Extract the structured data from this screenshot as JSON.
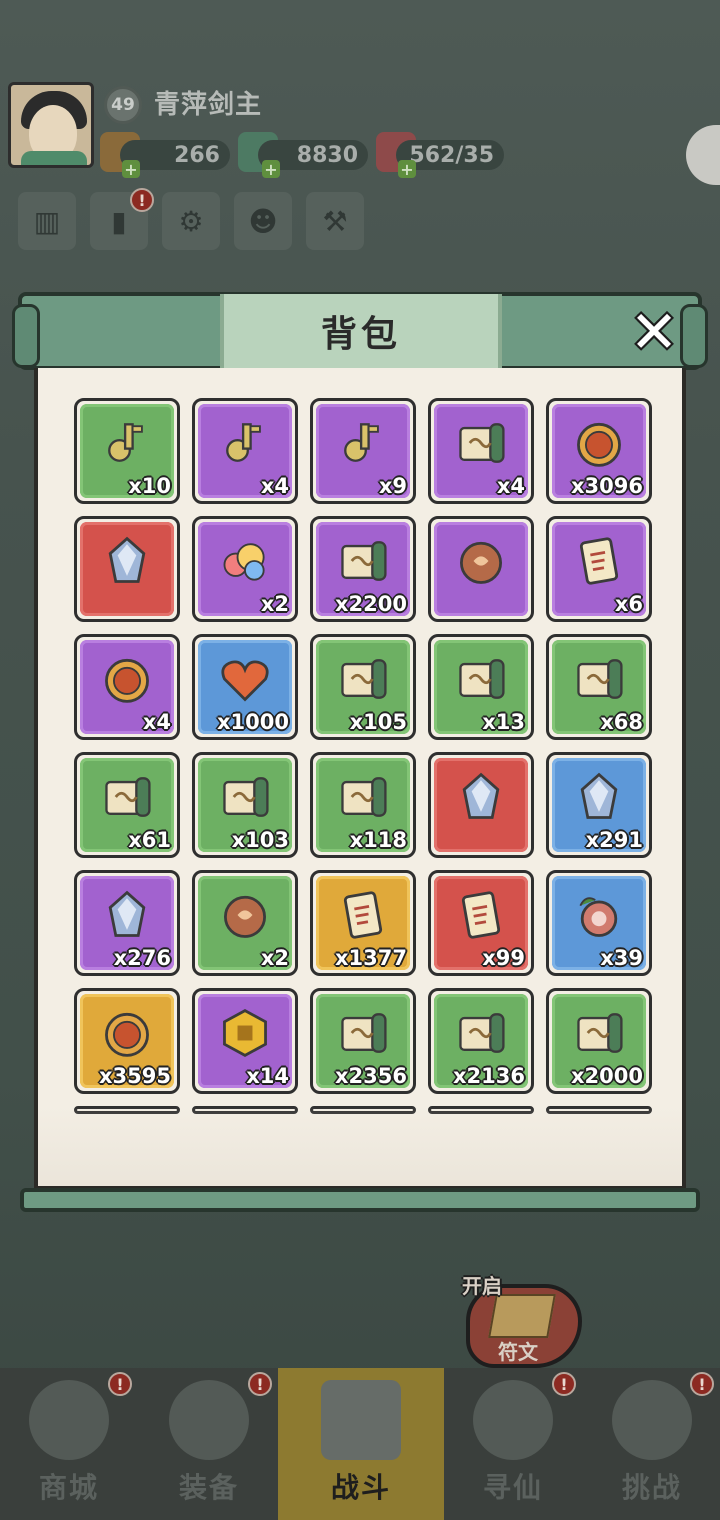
{
  "player": {
    "level": "49",
    "name": "青萍剑主"
  },
  "resources": [
    {
      "name": "gold",
      "value": "266"
    },
    {
      "name": "jade",
      "value": "8830"
    },
    {
      "name": "stamina",
      "value": "562/35"
    }
  ],
  "dialog": {
    "title": "背包",
    "close_glyph": "✕"
  },
  "items": [
    {
      "color": "g",
      "icon": "silver-key-icon",
      "qty": "x10"
    },
    {
      "color": "p",
      "icon": "gold-key-icon",
      "qty": "x4"
    },
    {
      "color": "p",
      "icon": "bell-key-icon",
      "qty": "x9"
    },
    {
      "color": "p",
      "icon": "beast-scroll-icon",
      "qty": "x4"
    },
    {
      "color": "p",
      "icon": "gold-coin-icon",
      "qty": "x3096"
    },
    {
      "color": "r",
      "icon": "crystal-icon",
      "qty": ""
    },
    {
      "color": "p",
      "icon": "rainbow-cloud-icon",
      "qty": "x2"
    },
    {
      "color": "p",
      "icon": "scroll-horn-icon",
      "qty": "x2200"
    },
    {
      "color": "p",
      "icon": "dragon-egg-icon",
      "qty": ""
    },
    {
      "color": "p",
      "icon": "letter-icon",
      "qty": "x6"
    },
    {
      "color": "p",
      "icon": "token-icon",
      "qty": "x4"
    },
    {
      "color": "b",
      "icon": "heart-icon",
      "qty": "x1000"
    },
    {
      "color": "g",
      "icon": "scroll-icon",
      "qty": "x105"
    },
    {
      "color": "g",
      "icon": "scroll-icon",
      "qty": "x13"
    },
    {
      "color": "g",
      "icon": "scroll-icon",
      "qty": "x68"
    },
    {
      "color": "g",
      "icon": "scroll-icon",
      "qty": "x61"
    },
    {
      "color": "g",
      "icon": "scroll-icon",
      "qty": "x103"
    },
    {
      "color": "g",
      "icon": "scroll-icon",
      "qty": "x118"
    },
    {
      "color": "r",
      "icon": "crystal-ball-icon",
      "qty": ""
    },
    {
      "color": "b",
      "icon": "ore-icon",
      "qty": "x291"
    },
    {
      "color": "p",
      "icon": "gem-pile-icon",
      "qty": "x276"
    },
    {
      "color": "g",
      "icon": "orb-icon",
      "qty": "x2"
    },
    {
      "color": "y",
      "icon": "jade-tablet-icon",
      "qty": "x1377"
    },
    {
      "color": "r",
      "icon": "talisman-icon",
      "qty": "x99"
    },
    {
      "color": "b",
      "icon": "meat-icon",
      "qty": "x39"
    },
    {
      "color": "y",
      "icon": "points-token-icon",
      "qty": "x3595"
    },
    {
      "color": "p",
      "icon": "honeycomb-icon",
      "qty": "x14"
    },
    {
      "color": "g",
      "icon": "wing-scroll-icon",
      "qty": "x2356"
    },
    {
      "color": "g",
      "icon": "fire-scroll-icon",
      "qty": "x2136"
    },
    {
      "color": "g",
      "icon": "spirit-scroll-icon",
      "qty": "x2000"
    }
  ],
  "item_colors": {
    "g": "#6db063",
    "p": "#a262cf",
    "r": "#d4524c",
    "b": "#5d98d8",
    "y": "#e0a93a"
  },
  "rune": {
    "open": "开启",
    "label": "符文"
  },
  "nav": [
    {
      "label": "商城",
      "active": false
    },
    {
      "label": "装备",
      "active": false
    },
    {
      "label": "战斗",
      "active": true
    },
    {
      "label": "寻仙",
      "active": false
    },
    {
      "label": "挑战",
      "active": false
    }
  ]
}
